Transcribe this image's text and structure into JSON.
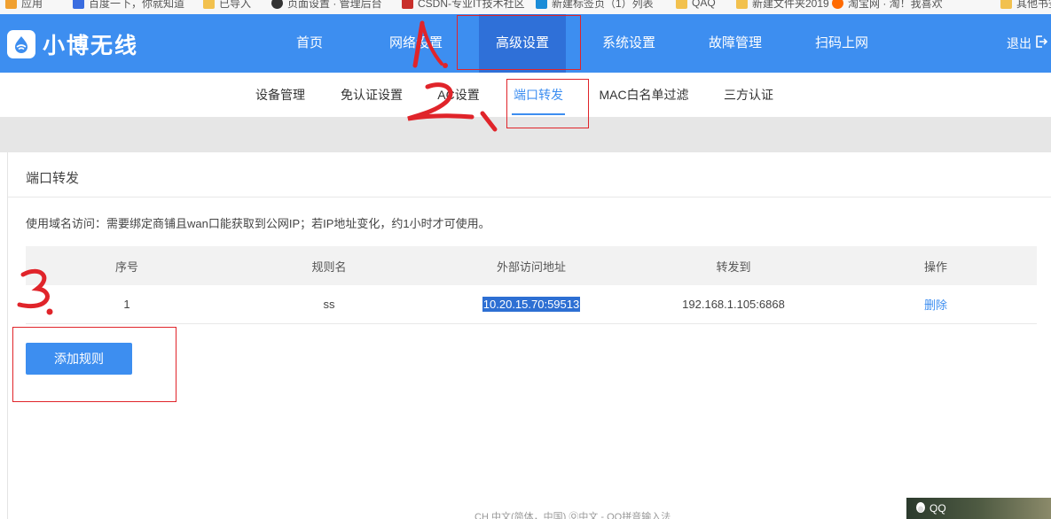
{
  "bookmarks": [
    {
      "label": "应用",
      "color": "#f0a030"
    },
    {
      "label": "百度一下，你就知道",
      "color": "#3a6de0"
    },
    {
      "label": "已导入",
      "color": "#f2c14e"
    },
    {
      "label": "页面设置 · 管理后台",
      "color": "#333333"
    },
    {
      "label": "CSDN-专业IT技术社区",
      "color": "#c9302c"
    },
    {
      "label": "新建标签页（1）列表",
      "color": "#1a8cd8"
    },
    {
      "label": "QAQ",
      "color": "#f2c14e"
    },
    {
      "label": "新建文件夹2019",
      "color": "#f2c14e"
    },
    {
      "label": "淘宝网 · 淘！我喜欢",
      "color": "#ff6a00"
    },
    {
      "label": "其他书签",
      "color": "#f2c14e"
    }
  ],
  "brand": {
    "name": "小博无线",
    "accent": "#3d8ef0"
  },
  "nav": {
    "items": [
      "首页",
      "网络设置",
      "高级设置",
      "系统设置",
      "故障管理",
      "扫码上网"
    ],
    "active": "高级设置",
    "logout": "退出"
  },
  "subnav": {
    "items": [
      "设备管理",
      "免认证设置",
      "AC设置",
      "端口转发",
      "MAC白名单过滤",
      "三方认证"
    ],
    "active": "端口转发"
  },
  "panel": {
    "title": "端口转发",
    "notice": "使用域名访问：需要绑定商铺且wan口能获取到公网IP；若IP地址变化，约1小时才可使用。"
  },
  "table": {
    "headers": [
      "序号",
      "规则名",
      "外部访问地址",
      "转发到",
      "操作"
    ],
    "rows": [
      {
        "index": "1",
        "name": "ss",
        "external": "10.20.15.70:59513",
        "forward": "192.168.1.105:6868",
        "action": "删除"
      }
    ]
  },
  "add_button": "添加规则",
  "taskbar": {
    "ime": "CH 中文(简体，中国)    Ⓠ中文 - QQ拼音输入法",
    "qq": "QQ"
  },
  "icons": [
    "logo-wifi-icon",
    "logout-icon",
    "qq-penguin-icon"
  ],
  "annotation_color": "#e0242a"
}
